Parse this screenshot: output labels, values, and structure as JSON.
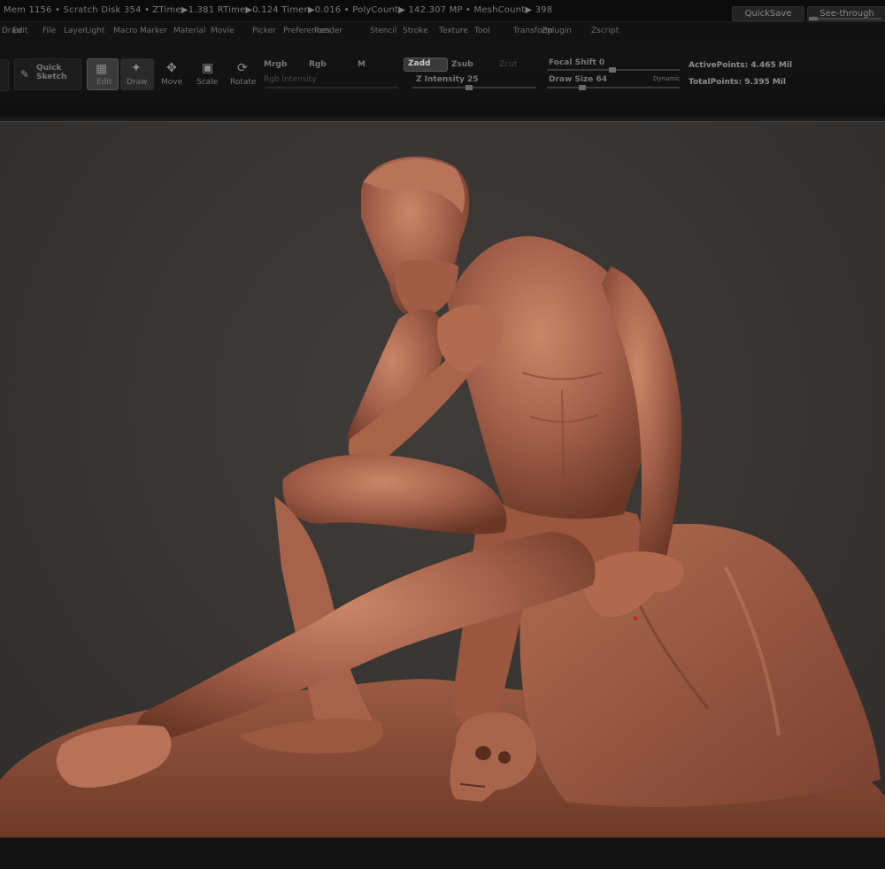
{
  "status": {
    "text": "Mem 1156  • Scratch Disk 354  •  ZTime▶1.381  RTime▶0.124  Timer▶0.016  • PolyCount▶ 142.307  MP   • MeshCount▶ 398",
    "quicksave": "QuickSave",
    "seethrough": "See-through"
  },
  "menu": [
    "Draw",
    "Edit",
    "File",
    "Layer",
    "Light",
    "Macro",
    "Marker",
    "Material",
    "Movie",
    "Picker",
    "Preferences",
    "Render",
    "Stencil",
    "Stroke",
    "Texture",
    "Tool",
    "Transform",
    "Zplugin",
    "Zscript"
  ],
  "toolbar": {
    "quick_sketch": "Quick Sketch",
    "edit": "Edit",
    "draw": "Draw",
    "move": "Move",
    "scale": "Scale",
    "rotate": "Rotate",
    "mrgb": "Mrgb",
    "rgb": "Rgb",
    "m": "M",
    "zadd": "Zadd",
    "zsub": "Zsub",
    "zcut": "Zcut",
    "rgb_intensity": "Rgb Intensity",
    "z_intensity": "Z Intensity 25",
    "focal_shift": "Focal Shift 0",
    "draw_size": "Draw Size 64",
    "dynamic": "Dynamic",
    "active_points": "ActivePoints: 4.465 Mil",
    "total_points": "TotalPoints: 9.395 Mil"
  },
  "colors": {
    "clay": "#a8644a",
    "clay_light": "#c88264",
    "clay_dark": "#6e3a28",
    "canvas_bg": "#373432"
  }
}
